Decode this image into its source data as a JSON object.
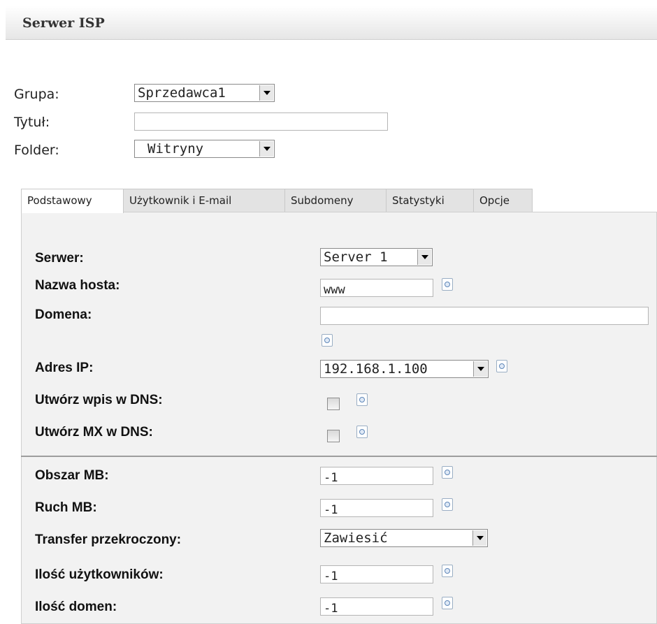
{
  "header": {
    "title": "Serwer ISP"
  },
  "top_form": {
    "group_label": "Grupa:",
    "group_value": "Sprzedawca1",
    "title_label": "Tytuł:",
    "title_value": "",
    "folder_label": "Folder:",
    "folder_value": "Witryny"
  },
  "tabs": [
    "Podstawowy",
    "Użytkownik i E-mail",
    "Subdomeny",
    "Statystyki",
    "Opcje"
  ],
  "fields": {
    "server_label": "Serwer:",
    "server_value": "Server 1",
    "hostname_label": "Nazwa hosta:",
    "hostname_value": "www",
    "domain_label": "Domena:",
    "domain_value": "",
    "ip_label": "Adres IP:",
    "ip_value": "192.168.1.100",
    "dns_label": "Utwórz wpis w DNS:",
    "dns_checked": false,
    "mx_label": "Utwórz MX w DNS:",
    "mx_checked": false,
    "space_label": "Obszar MB:",
    "space_value": "-1",
    "traffic_label": "Ruch MB:",
    "traffic_value": "-1",
    "transfer_label": "Transfer przekroczony:",
    "transfer_value": "Zawiesić",
    "users_label": "Ilość użytkowników:",
    "users_value": "-1",
    "domains_label": "Ilość domen:",
    "domains_value": "-1"
  }
}
